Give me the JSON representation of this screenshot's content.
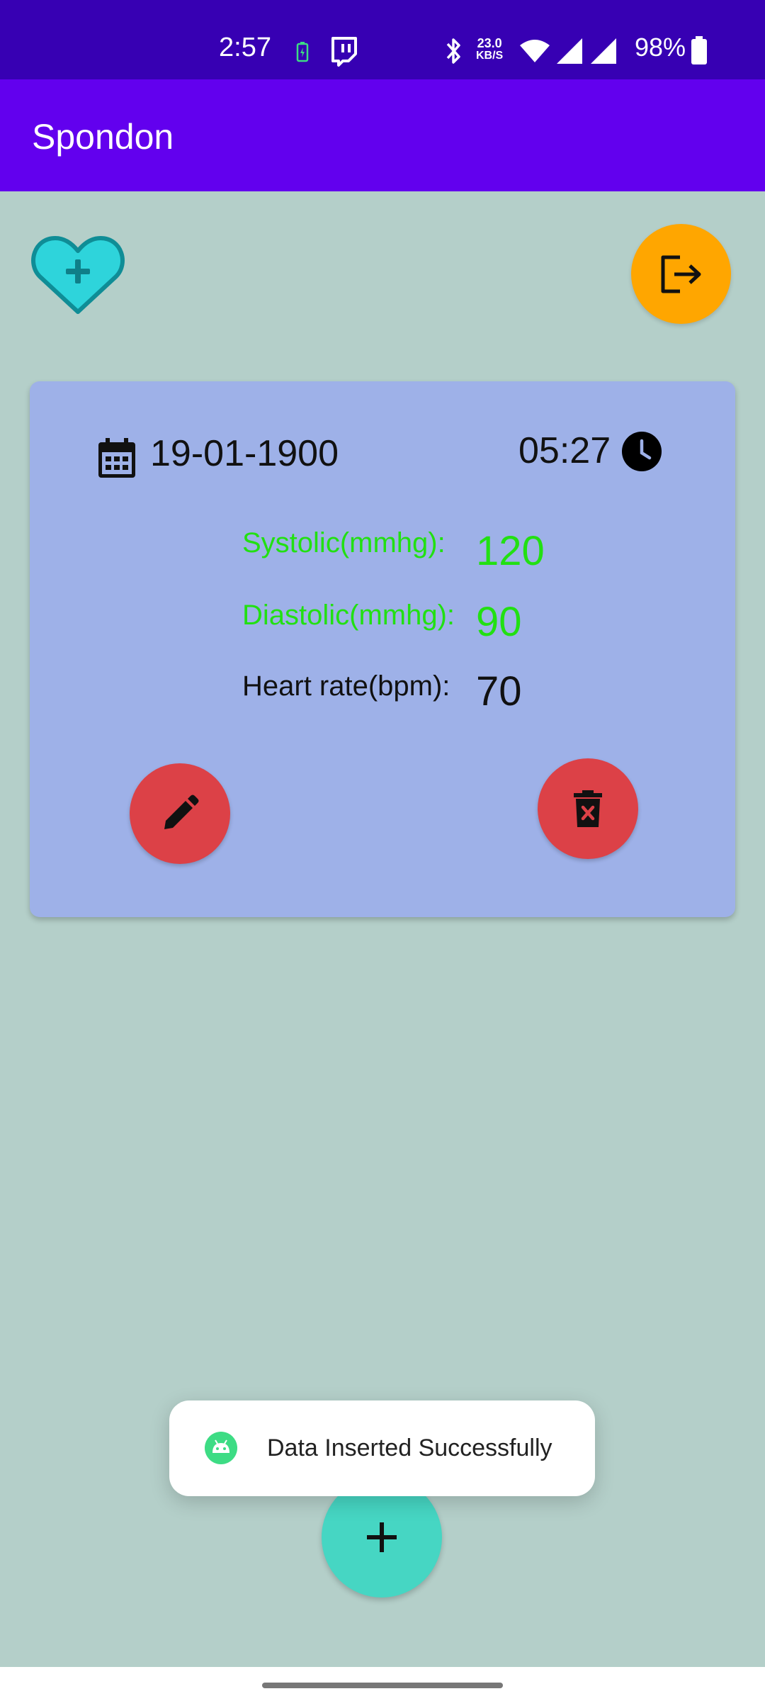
{
  "status_bar": {
    "time": "2:57",
    "network_speed_value": "23.0",
    "network_speed_unit": "KB/S",
    "battery_percent": "98%",
    "icons": [
      "battery-saver-icon",
      "twitch-icon",
      "bluetooth-icon",
      "wifi-icon",
      "signal-icon",
      "signal-icon",
      "battery-icon"
    ]
  },
  "app_bar": {
    "title": "Spondon"
  },
  "record": {
    "date": "19-01-1900",
    "time": "05:27",
    "systolic_label": "Systolic(mmhg):",
    "systolic_value": "120",
    "diastolic_label": "Diastolic(mmhg):",
    "diastolic_value": "90",
    "heart_rate_label": "Heart rate(bpm):",
    "heart_rate_value": "70"
  },
  "toast": {
    "message": "Data Inserted Successfully"
  },
  "colors": {
    "status_bar": "#3700b3",
    "app_bar": "#6200ee",
    "background": "#b4cfc9",
    "card": "#9eb1e8",
    "logout_fab": "#ffa600",
    "action_fab": "#dc4147",
    "add_fab": "#46d6c3",
    "accent_green": "#22e012"
  }
}
